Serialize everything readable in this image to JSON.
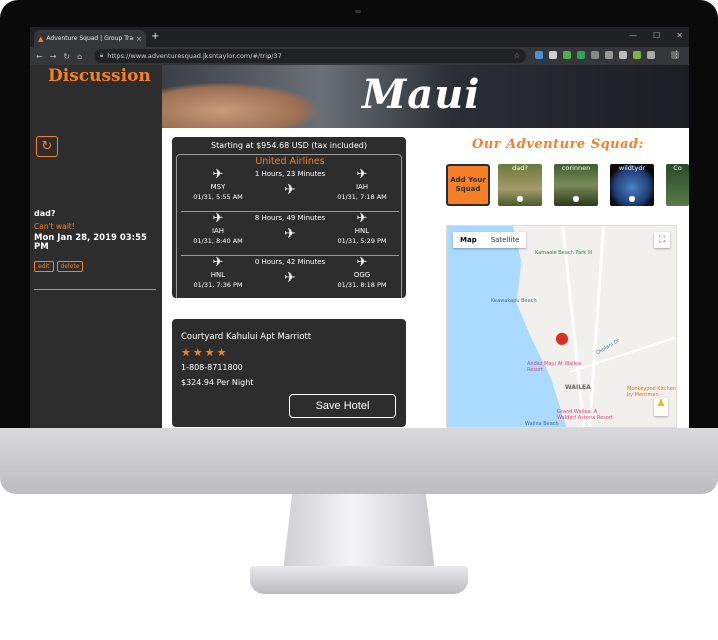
{
  "browser": {
    "tab_title": "Adventure Squad | Group Travel",
    "tab_close": "×",
    "new_tab": "+",
    "url": "https://www.adventuresquad.jksntaylor.com/#/trip/37"
  },
  "sidebar": {
    "title": "Discussion",
    "message": {
      "author": "dad?",
      "text": "Can't wait!",
      "date": "Mon Jan 28, 2019 03:55 PM",
      "edit_label": "edit",
      "delete_label": "delete"
    }
  },
  "trip": {
    "title": "Maui"
  },
  "flight": {
    "price_text": "Starting at $954.68 USD (tax included)",
    "airline": "United Airlines",
    "segments": [
      {
        "from": "MSY",
        "depart": "01/31, 5:55 AM",
        "duration": "1 Hours, 23 Minutes",
        "to": "IAH",
        "arrive": "01/31, 7:18 AM"
      },
      {
        "from": "IAH",
        "depart": "01/31, 8:40 AM",
        "duration": "8 Hours, 49 Minutes",
        "to": "HNL",
        "arrive": "01/31, 5:29 PM"
      },
      {
        "from": "HNL",
        "depart": "01/31, 7:36 PM",
        "duration": "0 Hours, 42 Minutes",
        "to": "OGG",
        "arrive": "01/31, 8:18 PM"
      }
    ]
  },
  "hotel": {
    "name": "Courtyard Kahului Apt Marriott",
    "stars": "★★★★",
    "phone": "1-808-8711800",
    "rate": "$324.94 Per Night",
    "save_label": "Save Hotel"
  },
  "squad": {
    "title": "Our Adventure Squad:",
    "add_label": "Add Your Squad",
    "members": [
      {
        "name": "dad?",
        "color": "#6b7a3a"
      },
      {
        "name": "corinnen",
        "color": "#3f5f2e"
      },
      {
        "name": "wildtydr",
        "color": "#1f3f7a"
      },
      {
        "name": "Co",
        "color": "#2b4a2a"
      }
    ]
  },
  "map": {
    "map_label": "Map",
    "satellite_label": "Satellite",
    "labels": {
      "kamaole": "Kamaole Beach Park III",
      "keawakapu": "Keawakapu Beach",
      "andaz": "Andaz Maui At Wailea Resort",
      "wailea": "WAILEA",
      "monkeypod": "Monkeypod Kitchen by Merriman",
      "grand": "Grand Wailea: A Waldorf Astoria Resort",
      "wailea_beach": "Wailea Beach",
      "okolani": "Okolani Dr"
    }
  },
  "colors": {
    "accent": "#f58025",
    "panel": "#2d2d2d"
  }
}
